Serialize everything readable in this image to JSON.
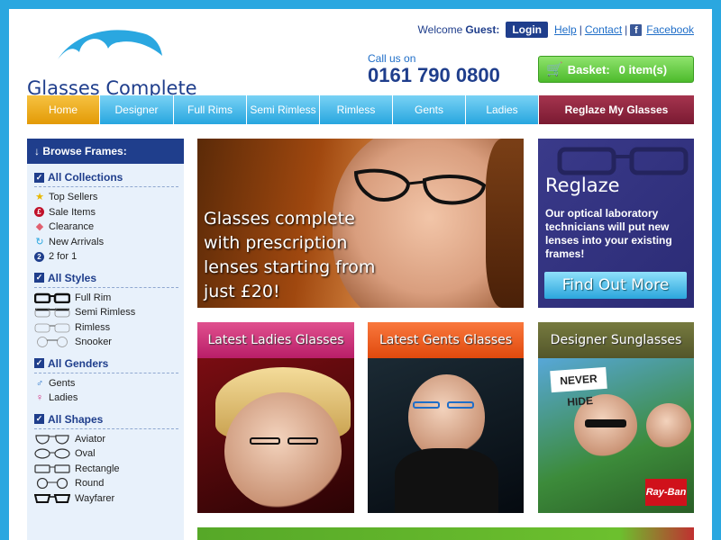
{
  "header": {
    "logo_text": "Glasses Complete",
    "welcome_label": "Welcome",
    "guest_label": "Guest:",
    "login_label": "Login",
    "links": [
      "Help",
      "Contact",
      "Facebook"
    ],
    "call_label": "Call us on",
    "phone": "0161 790 0800",
    "basket_label": "Basket:",
    "basket_count": "0 item(s)"
  },
  "nav": {
    "items": [
      "Home",
      "Designer",
      "Full Rims",
      "Semi Rimless",
      "Rimless",
      "Gents",
      "Ladies",
      "Reglaze My Glasses"
    ]
  },
  "sidebar": {
    "title": "Browse Frames:",
    "collections": {
      "title": "All Collections",
      "items": [
        "Top Sellers",
        "Sale Items",
        "Clearance",
        "New Arrivals",
        "2 for 1"
      ]
    },
    "styles": {
      "title": "All Styles",
      "items": [
        "Full Rim",
        "Semi Rimless",
        "Rimless",
        "Snooker"
      ]
    },
    "genders": {
      "title": "All Genders",
      "items": [
        "Gents",
        "Ladies"
      ]
    },
    "shapes": {
      "title": "All Shapes",
      "items": [
        "Aviator",
        "Oval",
        "Rectangle",
        "Round",
        "Wayfarer"
      ]
    }
  },
  "hero": {
    "text": "Glasses complete with prescription lenses starting from just £20!"
  },
  "reglaze": {
    "title": "Reglaze",
    "text": "Our optical laboratory technicians will put new lenses into your existing frames!",
    "button": "Find Out More"
  },
  "promos": {
    "ladies": "Latest Ladies Glasses",
    "gents": "Latest Gents Glasses",
    "sunglasses": "Designer Sunglasses",
    "sign_text": "NEVER HIDE",
    "brand_badge": "Ray-Ban"
  },
  "colors": {
    "page_bg": "#2aa7e0",
    "brand_navy": "#1f3e8c",
    "nav_blue": "#27a6df",
    "nav_home": "#e39a06",
    "nav_reglaze": "#7a1a32",
    "basket_green": "#4dbb2c"
  }
}
